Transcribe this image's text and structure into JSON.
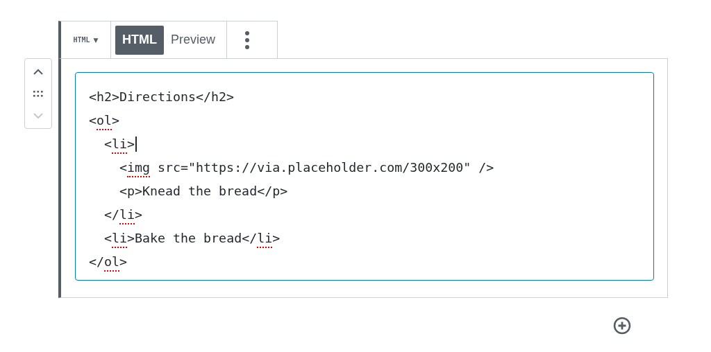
{
  "mover": {
    "up": {
      "disabled": false
    },
    "down": {
      "disabled": true
    }
  },
  "toolbar": {
    "block_switcher": {
      "label": "HTML",
      "caret": "▼"
    },
    "tabs": [
      {
        "label": "HTML",
        "selected": true
      },
      {
        "label": "Preview",
        "selected": false
      }
    ]
  },
  "editor": {
    "lines": [
      {
        "segments": [
          {
            "text": "<h2>Directions</h2>",
            "misspelled": false
          }
        ],
        "caret": false
      },
      {
        "segments": [
          {
            "text": "<",
            "misspelled": false
          },
          {
            "text": "ol",
            "misspelled": true
          },
          {
            "text": ">",
            "misspelled": false
          }
        ],
        "caret": false
      },
      {
        "segments": [
          {
            "text": "  <",
            "misspelled": false
          },
          {
            "text": "li",
            "misspelled": true
          },
          {
            "text": ">",
            "misspelled": false
          }
        ],
        "caret": true
      },
      {
        "segments": [
          {
            "text": "    <",
            "misspelled": false
          },
          {
            "text": "img",
            "misspelled": true
          },
          {
            "text": " src=\"https://via.placeholder.com/300x200\" />",
            "misspelled": false
          }
        ],
        "caret": false
      },
      {
        "segments": [
          {
            "text": "    <p>Knead the bread</p>",
            "misspelled": false
          }
        ],
        "caret": false
      },
      {
        "segments": [
          {
            "text": "  </",
            "misspelled": false
          },
          {
            "text": "li",
            "misspelled": true
          },
          {
            "text": ">",
            "misspelled": false
          }
        ],
        "caret": false
      },
      {
        "segments": [
          {
            "text": "  <",
            "misspelled": false
          },
          {
            "text": "li",
            "misspelled": true
          },
          {
            "text": ">Bake the bread</",
            "misspelled": false
          },
          {
            "text": "li",
            "misspelled": true
          },
          {
            "text": ">",
            "misspelled": false
          }
        ],
        "caret": false
      },
      {
        "segments": [
          {
            "text": "</",
            "misspelled": false
          },
          {
            "text": "ol",
            "misspelled": true
          },
          {
            "text": ">",
            "misspelled": false
          }
        ],
        "caret": false
      }
    ]
  }
}
